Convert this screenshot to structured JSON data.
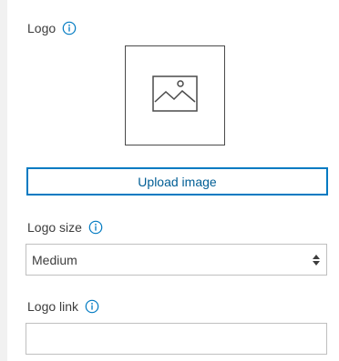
{
  "logo": {
    "label": "Logo",
    "info_icon": "info-icon",
    "preview_icon": "image-placeholder-icon",
    "upload_label": "Upload image"
  },
  "logo_size": {
    "label": "Logo size",
    "info_icon": "info-icon",
    "selected": "Medium",
    "control_icon": "select-chevrons-icon"
  },
  "logo_link": {
    "label": "Logo link",
    "info_icon": "info-icon",
    "value": "",
    "placeholder": ""
  },
  "colors": {
    "accent": "#007ac2",
    "accent_text": "#005e95",
    "text": "#3d3d3d",
    "border": "#bfbfbf"
  }
}
